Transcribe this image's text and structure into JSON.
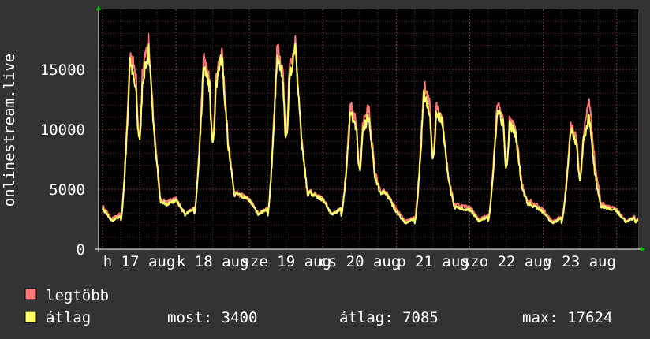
{
  "chart_data": {
    "type": "line",
    "ylabel": "onlinestream.live",
    "ylim": [
      0,
      20000
    ],
    "y_ticks": [
      "0",
      "5000",
      "10000",
      "15000"
    ],
    "y_tick_values": [
      0,
      5000,
      10000,
      15000
    ],
    "grid": true,
    "x_tick_labels": [
      {
        "text": "h 17 aug",
        "day": 0
      },
      {
        "text": "k 18 aug",
        "day": 1
      },
      {
        "text": "sze 19 aug",
        "day": 2
      },
      {
        "text": "cs 20 aug",
        "day": 3
      },
      {
        "text": "p 21 aug",
        "day": 4
      },
      {
        "text": "szo 22 aug",
        "day": 5
      },
      {
        "text": "v 23 aug",
        "day": 6
      }
    ],
    "days_span": 7.35,
    "daily_profile": {
      "hours": [
        0,
        2,
        4,
        6,
        7.5,
        9,
        10.5,
        11.5,
        12.5,
        13.5,
        15,
        16.5,
        17.5,
        18.5,
        19.5,
        20.5,
        21.5,
        22.5,
        23.3,
        24
      ],
      "note_hidden": true
    },
    "series": [
      {
        "name": "legtöbb",
        "color": "#ff7777",
        "days": [
          {
            "base": 3600,
            "peak1": 16500,
            "peak2": 17600
          },
          {
            "base": 4200,
            "peak1": 16000,
            "peak2": 16700
          },
          {
            "base": 4200,
            "peak1": 16900,
            "peak2": 17100
          },
          {
            "base": 4200,
            "peak1": 12000,
            "peak2": 11800
          },
          {
            "base": 3300,
            "peak1": 13700,
            "peak2": 11100
          },
          {
            "base": 3500,
            "peak1": 12300,
            "peak2": 10000
          },
          {
            "base": 3300,
            "peak1": 10500,
            "peak2": 12600
          },
          {
            "base": 3300,
            "peak1": 3300,
            "peak2": 3300
          }
        ]
      },
      {
        "name": "átlag",
        "color": "#ffff66",
        "days": [
          {
            "base": 3400,
            "peak1": 15600,
            "peak2": 16800
          },
          {
            "base": 4100,
            "peak1": 15300,
            "peak2": 16100
          },
          {
            "base": 4100,
            "peak1": 16000,
            "peak2": 16700
          },
          {
            "base": 4100,
            "peak1": 11400,
            "peak2": 11000
          },
          {
            "base": 3100,
            "peak1": 12900,
            "peak2": 10700
          },
          {
            "base": 3300,
            "peak1": 11800,
            "peak2": 9600
          },
          {
            "base": 3100,
            "peak1": 10000,
            "peak2": 11000
          },
          {
            "base": 3200,
            "peak1": 3200,
            "peak2": 3200
          }
        ]
      }
    ],
    "legend": [
      {
        "label": "legtöbb",
        "color": "#ff7777"
      },
      {
        "label": "átlag",
        "color": "#ffff66"
      }
    ],
    "stats": {
      "most": "most: 3400",
      "atlag": "átlag: 7085",
      "max": "max: 17624"
    },
    "colors": {
      "background": "#333333",
      "plot_background": "#000000",
      "grid_minor": "#5a2a2a",
      "grid_major": "#8a3a3a",
      "axis": "#ffffff",
      "arrow": "#00cc00"
    }
  }
}
